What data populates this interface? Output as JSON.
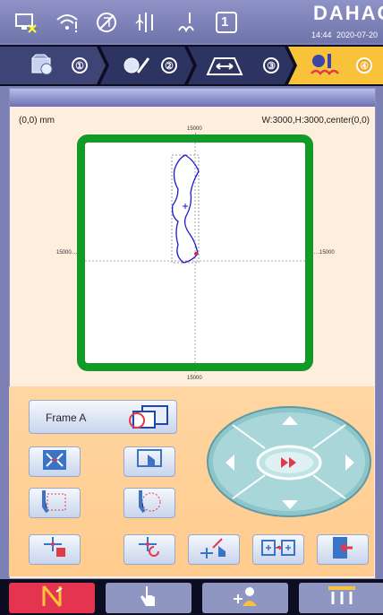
{
  "status": {
    "brand": "DAHAO",
    "time": "14:44",
    "date": "2020-07-20",
    "badge_number": "1",
    "icons": [
      "network-disconnected-icon",
      "wifi-warning-icon",
      "sewing-disabled-icon",
      "thread-tension-icon",
      "trim-icon",
      "number-badge-icon"
    ]
  },
  "steps": [
    {
      "number": "①",
      "icon": "pattern-file-icon"
    },
    {
      "number": "②",
      "icon": "pattern-edit-icon"
    },
    {
      "number": "③",
      "icon": "frame-size-icon"
    },
    {
      "number": "④",
      "icon": "embroidery-start-icon"
    }
  ],
  "panel": {
    "coord": "(0,0) mm",
    "size_info": "W:3000,H:3000,center(0,0)",
    "axis_top": "15000",
    "axis_bottom": "15000",
    "axis_left": "15000",
    "axis_right": "15000"
  },
  "controls": {
    "frame_label": "Frame A"
  },
  "colors": {
    "frame": "#129a26",
    "pattern": "#1a1ad0",
    "tab_active": "#e4344f",
    "tab_inactive": "#8f96c2"
  },
  "tabs": [
    "needle-trim-icon",
    "manual-hand-icon",
    "operator-icon",
    "needle-bar-icon"
  ]
}
